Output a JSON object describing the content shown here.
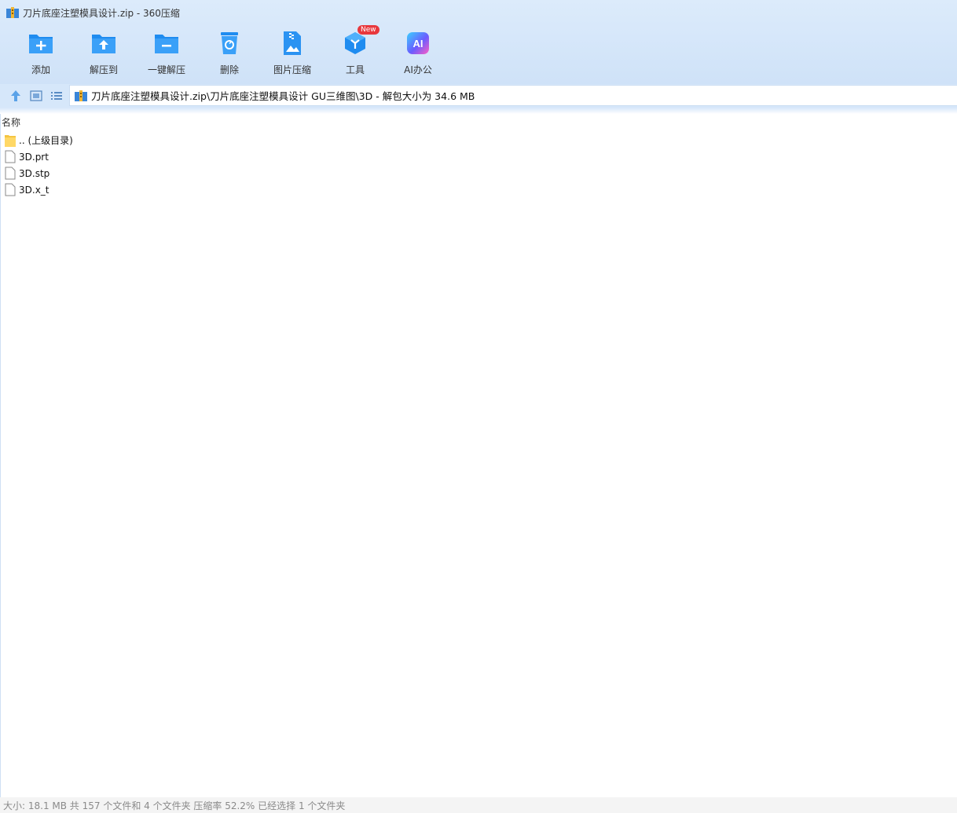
{
  "window": {
    "title": "刀片底座注塑模具设计.zip - 360压缩",
    "app_icon": "archive-app-icon"
  },
  "toolbar": {
    "buttons": [
      {
        "label": "添加",
        "icon": "add-folder-icon"
      },
      {
        "label": "解压到",
        "icon": "extract-to-icon"
      },
      {
        "label": "一键解压",
        "icon": "one-click-extract-icon"
      },
      {
        "label": "删除",
        "icon": "delete-trash-icon"
      },
      {
        "label": "图片压缩",
        "icon": "image-compress-icon"
      },
      {
        "label": "工具",
        "icon": "tools-icon",
        "badge": "New"
      },
      {
        "label": "AI办公",
        "icon": "ai-office-icon",
        "icon_text": "AI"
      }
    ]
  },
  "nav": {
    "path": "刀片底座注塑模具设计.zip\\刀片底座注塑模具设计 GU三维图\\3D - 解包大小为 34.6 MB"
  },
  "list": {
    "column_name": "名称",
    "items": [
      {
        "name": ".. (上级目录)",
        "type": "folder"
      },
      {
        "name": "3D.prt",
        "type": "file"
      },
      {
        "name": "3D.stp",
        "type": "file"
      },
      {
        "name": "3D.x_t",
        "type": "file"
      }
    ]
  },
  "status": {
    "text": "大小: 18.1 MB 共 157 个文件和 4 个文件夹 压缩率 52.2% 已经选择 1 个文件夹"
  },
  "colors": {
    "accent": "#2b8de8",
    "toolbar_bg": "#d6e7fa",
    "badge": "#e8383d"
  }
}
